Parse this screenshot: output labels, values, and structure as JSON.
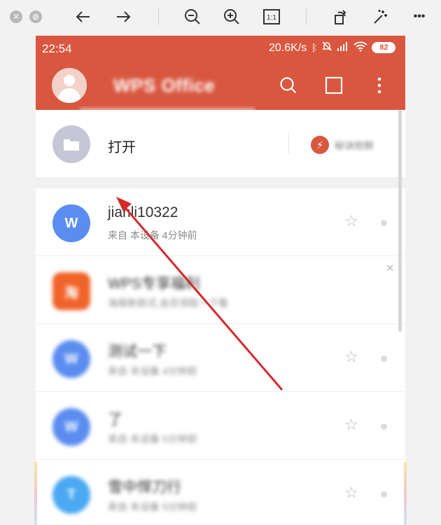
{
  "viewer": {
    "close_icon": "close-icon",
    "minimize_icon": "minimize-icon",
    "tools": [
      "back-arrow-icon",
      "forward-arrow-icon",
      "zoom-out-icon",
      "zoom-in-icon",
      "actual-size-icon",
      "rotate-icon",
      "magic-wand-icon",
      "more-icon"
    ],
    "actual_size_label": "1:1",
    "more_label": "•••"
  },
  "status_bar": {
    "time": "22:54",
    "network_speed": "20.6K/s",
    "battery": "82"
  },
  "app_bar": {
    "title": "WPS Office"
  },
  "open_row": {
    "label": "打开",
    "promo": "秘诀抢鲜"
  },
  "files": [
    {
      "name": "jianli10322",
      "meta": "来自 本设备    4分钟前",
      "icon": "W",
      "color": "#5b8df0",
      "blurred": false
    },
    {
      "name": "WPS专享福利",
      "meta": "海报新款式,会员领取一下看",
      "icon": "淘",
      "color": "#f0642a",
      "blurred": true
    },
    {
      "name": "测试一下",
      "meta": "来自 本设备  4分钟前",
      "icon": "W",
      "color": "#5b8df0",
      "blurred": true
    },
    {
      "name": "了",
      "meta": "来自 本设备  5分钟前",
      "icon": "W",
      "color": "#5b8df0",
      "blurred": true
    },
    {
      "name": "雪中悍刀行",
      "meta": "来自 本设备  5分钟前",
      "icon": "T",
      "color": "#4aa9f2",
      "blurred": true
    }
  ],
  "colors": {
    "accent": "#d9573f",
    "annotation_arrow": "#d42a2a"
  }
}
